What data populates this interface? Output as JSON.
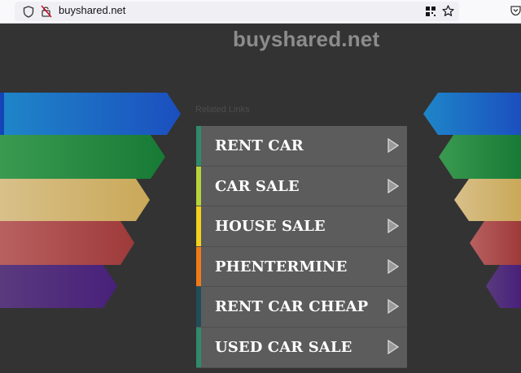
{
  "browser": {
    "url": "buyshared.net"
  },
  "site": {
    "title": "buyshared.net",
    "related_heading": "Related Links"
  },
  "links": [
    {
      "label": "RENT CAR",
      "accent": "#2e8b6b"
    },
    {
      "label": "CAR SALE",
      "accent": "#b7d33b"
    },
    {
      "label": "HOUSE SALE",
      "accent": "#f2d21b"
    },
    {
      "label": "PHENTERMINE",
      "accent": "#f07a1a"
    },
    {
      "label": "RENT CAR CHEAP",
      "accent": "#1f4e5a"
    },
    {
      "label": "USED CAR SALE",
      "accent": "#2e8b6b"
    }
  ],
  "decor_colors": [
    "#1b72c8",
    "#1f8a3c",
    "#d0b060",
    "#b05050",
    "#5a2e80"
  ]
}
